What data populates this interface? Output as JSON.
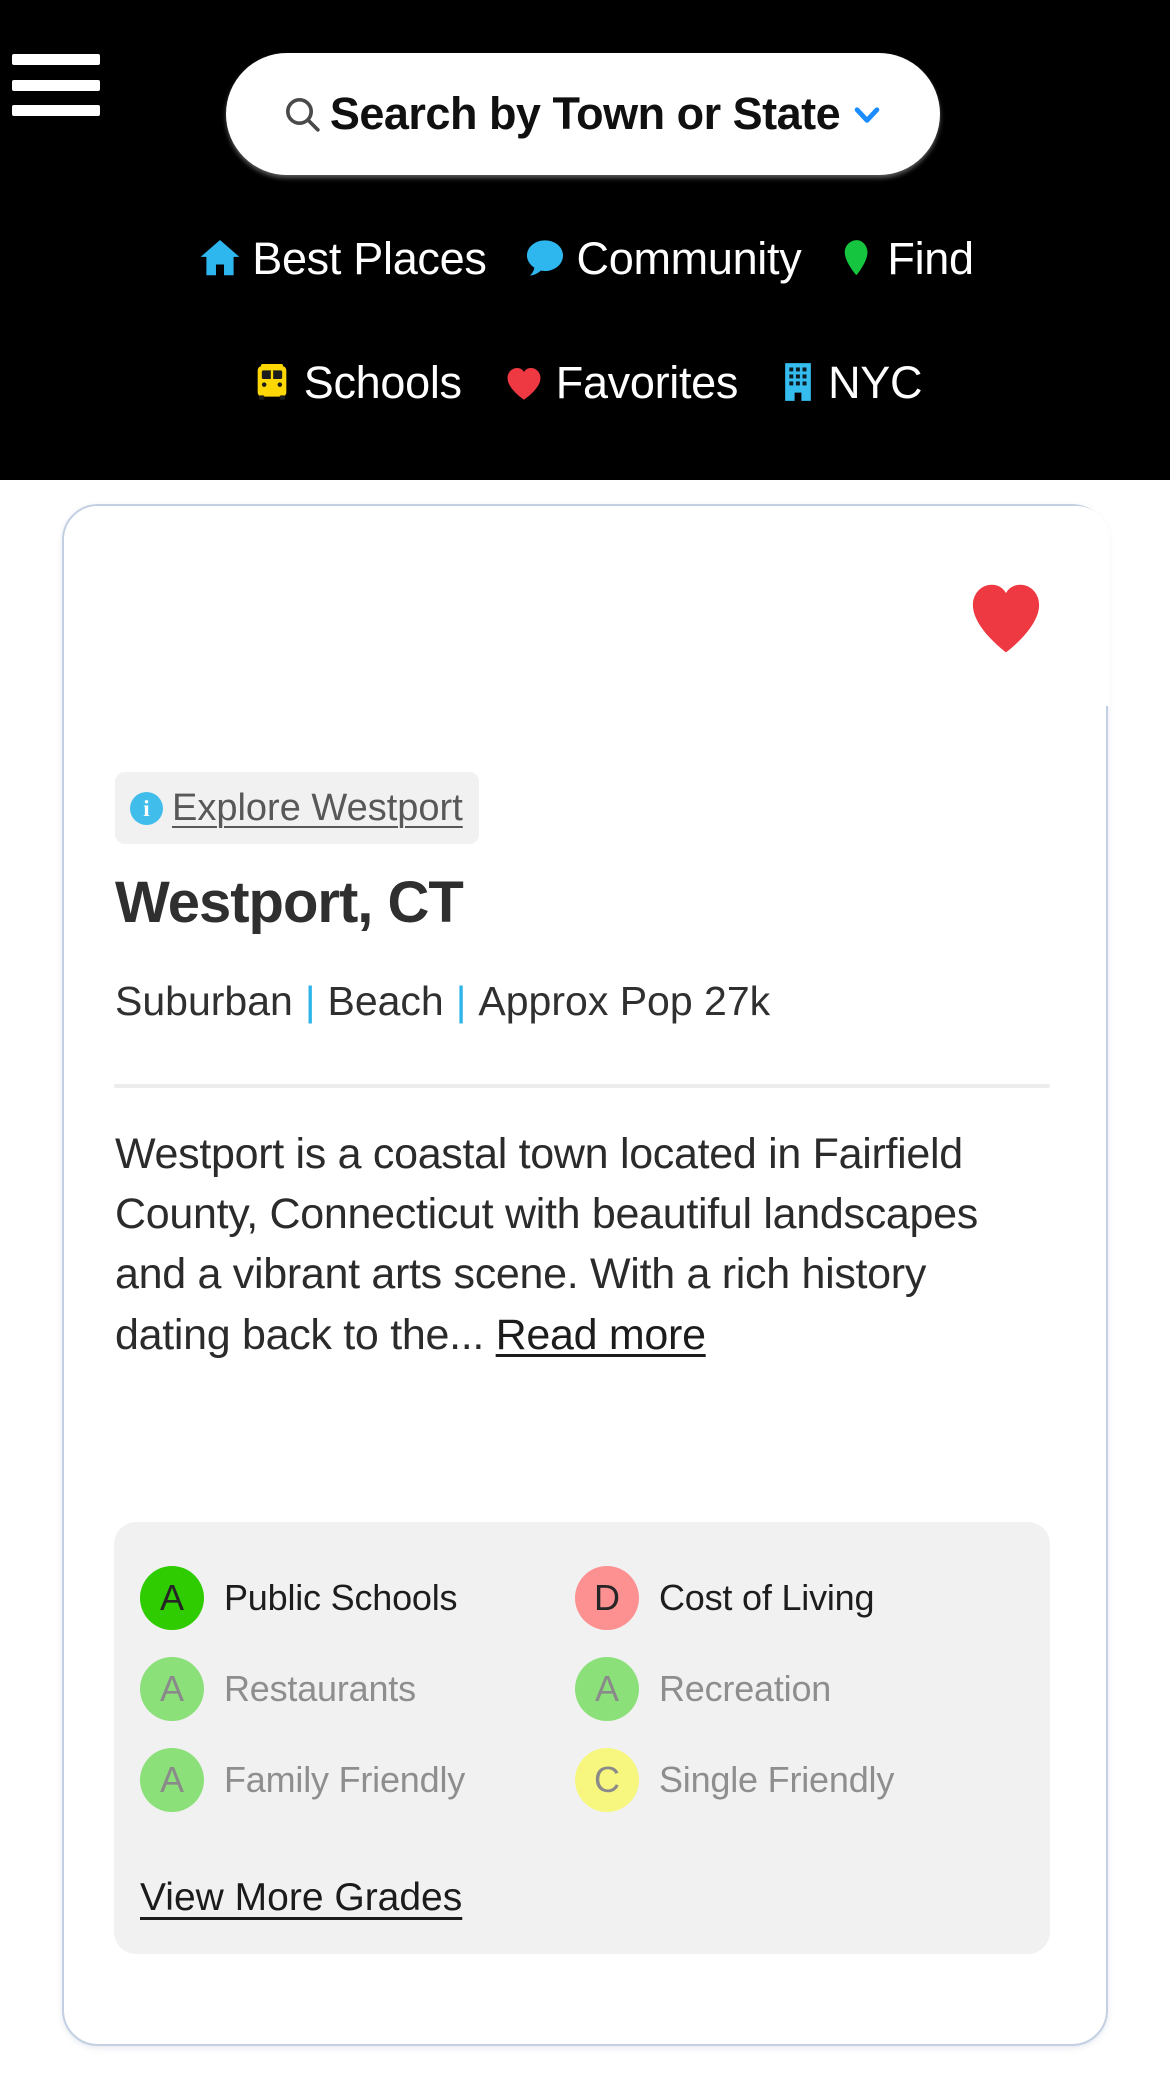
{
  "header": {
    "menu_icon": "hamburger-menu-icon",
    "search": {
      "icon": "search-icon",
      "placeholder": "Search by Town or State",
      "value": "",
      "caret_icon": "chevron-down-icon",
      "caret_color": "#1a8cff"
    },
    "nav_row_1": [
      {
        "icon": "home-icon",
        "icon_color": "#2eb6ef",
        "label": "Best Places"
      },
      {
        "icon": "chat-bubble-icon",
        "icon_color": "#2eb6ef",
        "label": "Community"
      },
      {
        "icon": "map-pin-icon",
        "icon_color": "#15c43f",
        "label": "Find"
      }
    ],
    "nav_row_2": [
      {
        "icon": "school-bus-icon",
        "icon_color": "#fcd703",
        "label": "Schools"
      },
      {
        "icon": "heart-icon",
        "icon_color": "#ee3842",
        "label": "Favorites"
      },
      {
        "icon": "building-icon",
        "icon_color": "#35bdef",
        "label": "NYC"
      }
    ]
  },
  "card": {
    "favorite_icon": "heart-icon",
    "favorite_color": "#ee3842",
    "favorited": true,
    "explore": {
      "info_icon": "info-icon",
      "label": "Explore Westport"
    },
    "title": "Westport, CT",
    "meta": {
      "items": [
        "Suburban",
        "Beach",
        "Approx Pop 27k"
      ],
      "separator": "|",
      "separator_color": "#2db4e8"
    },
    "description": "Westport is a coastal town located in Fairfield County, Connecticut with beautiful landscapes and a vibrant arts scene. With a rich history dating back to the...",
    "read_more_label": "Read more",
    "grades": [
      {
        "grade": "A",
        "label": "Public Schools",
        "color": "#2ecc00",
        "emphasis": "primary"
      },
      {
        "grade": "D",
        "label": "Cost of Living",
        "color": "#fd9191",
        "emphasis": "primary"
      },
      {
        "grade": "A",
        "label": "Restaurants",
        "color": "#8ce07a",
        "emphasis": "muted"
      },
      {
        "grade": "A",
        "label": "Recreation",
        "color": "#8ce07a",
        "emphasis": "muted"
      },
      {
        "grade": "A",
        "label": "Family Friendly",
        "color": "#8ce07a",
        "emphasis": "muted"
      },
      {
        "grade": "C",
        "label": "Single Friendly",
        "color": "#f7f77f",
        "emphasis": "muted"
      }
    ],
    "view_more_grades_label": "View More Grades"
  }
}
